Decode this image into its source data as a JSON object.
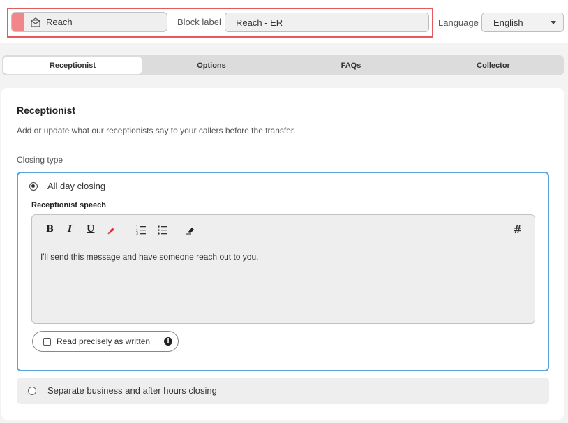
{
  "header": {
    "block_name": "Reach",
    "block_label_caption": "Block label",
    "block_label_value": "Reach - ER",
    "language_caption": "Language",
    "language_value": "English"
  },
  "tabs": [
    {
      "label": "Receptionist",
      "active": true
    },
    {
      "label": "Options",
      "active": false
    },
    {
      "label": "FAQs",
      "active": false
    },
    {
      "label": "Collector",
      "active": false
    }
  ],
  "panel": {
    "title": "Receptionist",
    "description": "Add or update what our receptionists say to your callers before the transfer.",
    "closing_type_label": "Closing type",
    "option_all_day": {
      "label": "All day closing",
      "selected": true,
      "speech_label": "Receptionist speech",
      "toolbar": {
        "bold": "B",
        "italic": "I",
        "underline": "U",
        "variable": "#"
      },
      "speech_text": "I'll send this message and have someone reach out to you.",
      "read_precisely_label": "Read precisely as written",
      "read_precisely_checked": false
    },
    "option_separate": {
      "label": "Separate business and after hours closing",
      "selected": false
    }
  },
  "colors": {
    "accent_border": "#5aa5de",
    "highlight": "#e45a5f",
    "block_swatch": "#f2858a"
  },
  "icons": {
    "block_type": "envelope-icon",
    "dropdown": "chevron-down-icon",
    "highlight": "highlighter-icon",
    "ordered_list": "ordered-list-icon",
    "bullet_list": "bullet-list-icon",
    "clear_format": "eraser-icon",
    "info": "info-icon"
  }
}
